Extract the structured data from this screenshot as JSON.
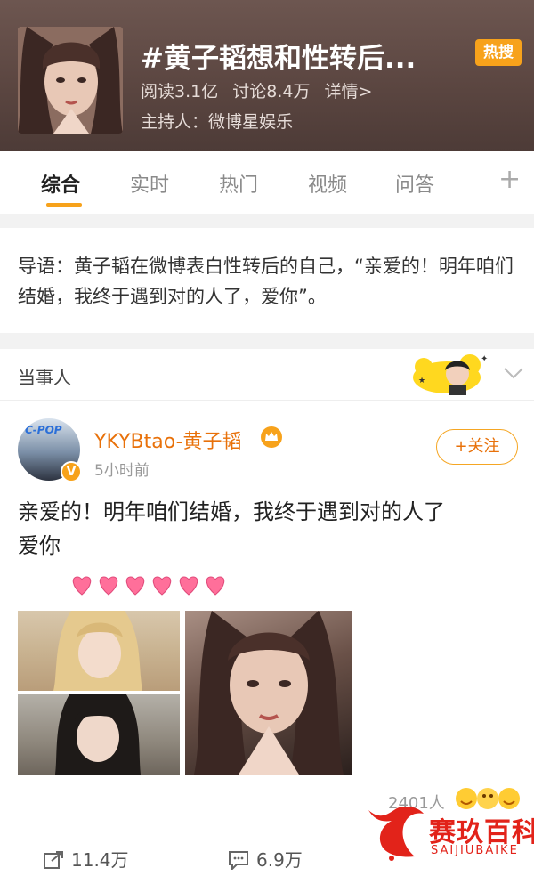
{
  "header": {
    "title": "#黄子韬想和性转后...",
    "badge": "热搜",
    "read": "阅读3.1亿",
    "discuss": "讨论8.4万",
    "detail": "详情>",
    "host": "主持人：微博星娱乐"
  },
  "tabs": [
    {
      "label": "综合",
      "active": true
    },
    {
      "label": "实时"
    },
    {
      "label": "热门"
    },
    {
      "label": "视频"
    },
    {
      "label": "问答"
    }
  ],
  "tab_add": "+",
  "intro": "导语：黄子韬在微博表白性转后的自己，“亲爱的！明年咱们结婚，我终于遇到对的人了，爱你”。",
  "party": {
    "label": "当事人"
  },
  "post": {
    "avatar_text": "C-POP",
    "username": "YKYBtao-黄子韬",
    "verified_mark": "V",
    "time": "5小时前",
    "follow": "+关注",
    "text_line1": "亲爱的！明年咱们结婚，我终于遇到对的人了",
    "text_line2": "爱你",
    "reactions": "2401人",
    "repost": "11.4万",
    "comment": "6.9万"
  },
  "watermark": {
    "cn": "赛玖百科",
    "en": "SAIJIUBAIKE"
  },
  "colors": {
    "accent": "#f7a21b",
    "username": "#e8710a",
    "header_bg": "#5a4540",
    "watermark": "#e2231a"
  }
}
